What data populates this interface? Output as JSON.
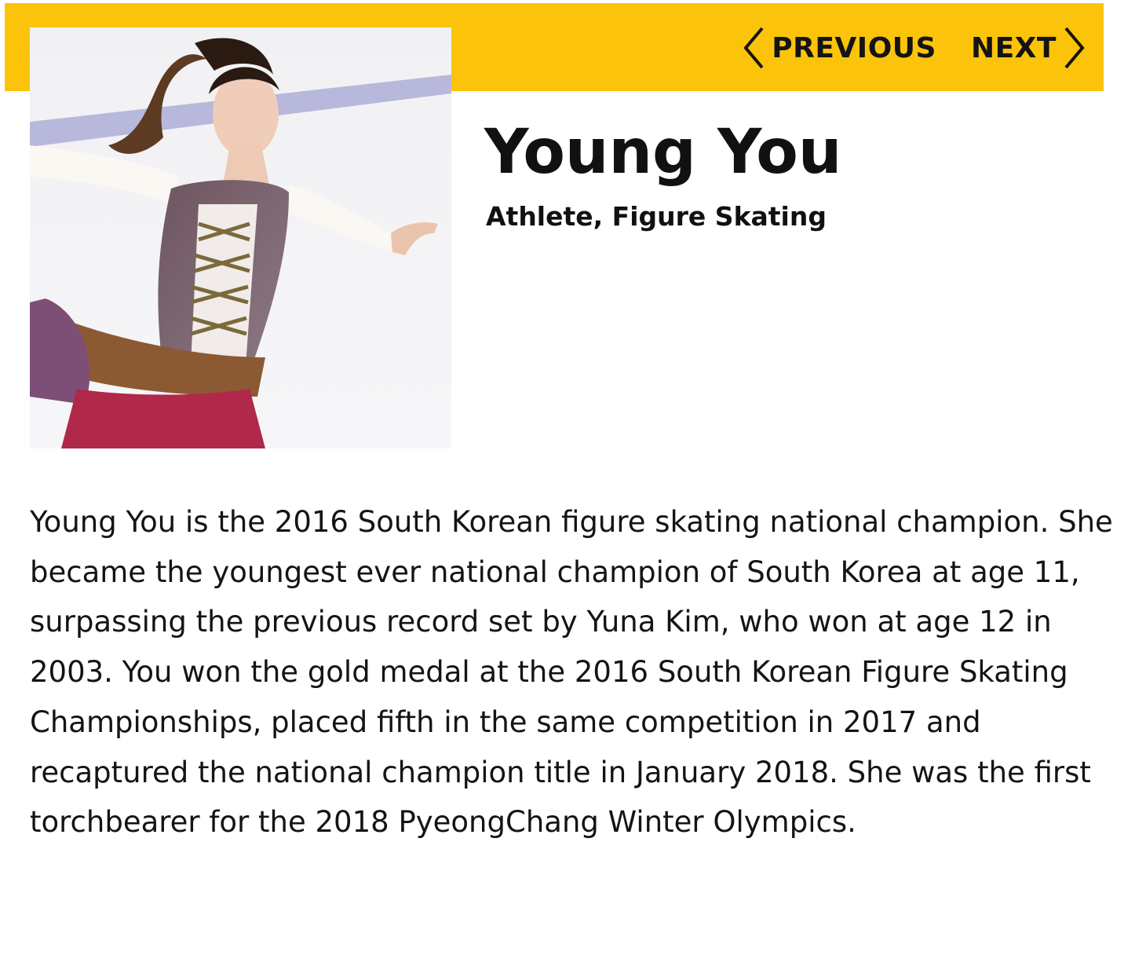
{
  "nav": {
    "previous_label": "PREVIOUS",
    "next_label": "NEXT",
    "previous_icon": "chevron-left-icon",
    "next_icon": "chevron-right-icon"
  },
  "profile": {
    "name": "Young You",
    "role": "Athlete, Figure Skating",
    "photo_alt": "Young You figure skating",
    "bio": "Young You is the 2016 South Korean figure skating national champion. She became the youngest ever national champion of South Korea at age 11, surpassing the previous record set by Yuna Kim, who won at age 12 in 2003. You won the gold medal at the 2016 South Korean Figure Skating Championships, placed fifth in the same competition in 2017 and recaptured the national champion title in January 2018. She was the first torchbearer for the 2018 PyeongChang Winter Olympics."
  },
  "colors": {
    "accent": "#fcc30b",
    "text": "#111111",
    "background": "#ffffff"
  }
}
